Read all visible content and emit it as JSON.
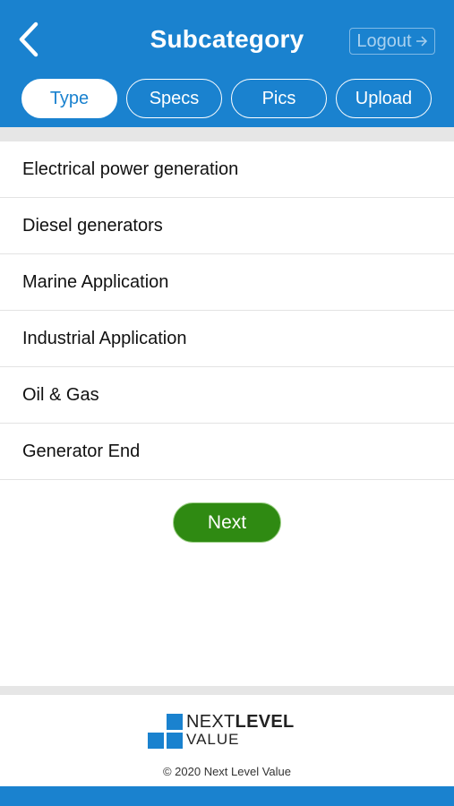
{
  "header": {
    "title": "Subcategory",
    "logout_label": "Logout",
    "back_icon": "chevron-left-icon",
    "logout_icon": "arrow-right-icon",
    "accent_color": "#1a82cf"
  },
  "tabs": [
    {
      "label": "Type",
      "active": true
    },
    {
      "label": "Specs",
      "active": false
    },
    {
      "label": "Pics",
      "active": false
    },
    {
      "label": "Upload",
      "active": false
    }
  ],
  "list": {
    "items": [
      "Electrical power generation",
      "Diesel generators",
      "Marine Application",
      "Industrial Application",
      "Oil & Gas",
      "Generator End"
    ]
  },
  "next_button": {
    "label": "Next",
    "color": "#2f8a12"
  },
  "footer": {
    "logo_next": "NEXT",
    "logo_level": "LEVEL",
    "logo_value": "VALUE",
    "copyright": "© 2020 Next Level Value"
  }
}
